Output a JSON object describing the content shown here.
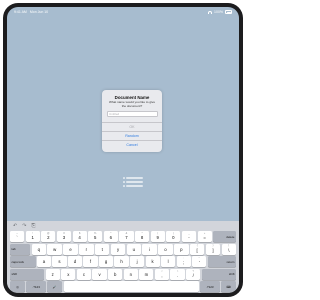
{
  "status_bar": {
    "time": "9:41 AM",
    "date": "Mon Jun 10",
    "battery": "100%"
  },
  "dialog": {
    "title": "Document Name",
    "message": "What name would you like to give the document?",
    "input_value": "",
    "input_placeholder": "Untitled",
    "ok_label": "OK",
    "random_label": "Random",
    "cancel_label": "Cancel"
  },
  "keyboard": {
    "shortcuts": [
      "undo-icon",
      "redo-icon",
      "paste-icon"
    ],
    "row1": [
      {
        "main": "`",
        "sub": "~"
      },
      {
        "main": "1",
        "sub": "!"
      },
      {
        "main": "2",
        "sub": "@"
      },
      {
        "main": "3",
        "sub": "#"
      },
      {
        "main": "4",
        "sub": "$"
      },
      {
        "main": "5",
        "sub": "%"
      },
      {
        "main": "6",
        "sub": "^"
      },
      {
        "main": "7",
        "sub": "&"
      },
      {
        "main": "8",
        "sub": "*"
      },
      {
        "main": "9",
        "sub": "("
      },
      {
        "main": "0",
        "sub": ")"
      },
      {
        "main": "-",
        "sub": "_"
      },
      {
        "main": "=",
        "sub": "+"
      }
    ],
    "delete_label": "delete",
    "tab_label": "tab",
    "row2": [
      "q",
      "w",
      "e",
      "r",
      "t",
      "y",
      "u",
      "i",
      "o",
      "p"
    ],
    "row2_extra": [
      {
        "main": "[",
        "sub": "{"
      },
      {
        "main": "]",
        "sub": "}"
      },
      {
        "main": "\\",
        "sub": "|"
      }
    ],
    "caps_label": "caps lock",
    "row3": [
      "a",
      "s",
      "d",
      "f",
      "g",
      "h",
      "j",
      "k",
      "l"
    ],
    "row3_extra": [
      {
        "main": ";",
        "sub": ":"
      },
      {
        "main": "'",
        "sub": "\""
      }
    ],
    "return_label": "return",
    "shift_label": "shift",
    "row4": [
      "z",
      "x",
      "c",
      "v",
      "b",
      "n",
      "m"
    ],
    "row4_extra": [
      {
        "main": ",",
        "sub": "<"
      },
      {
        "main": ".",
        "sub": ">"
      },
      {
        "main": "/",
        "sub": "?"
      }
    ],
    "globe_icon": "globe-icon",
    "num_label": ".?123",
    "mic_icon": "microphone-icon",
    "space_label": "",
    "dismiss_icon": "keyboard-dismiss-icon"
  }
}
